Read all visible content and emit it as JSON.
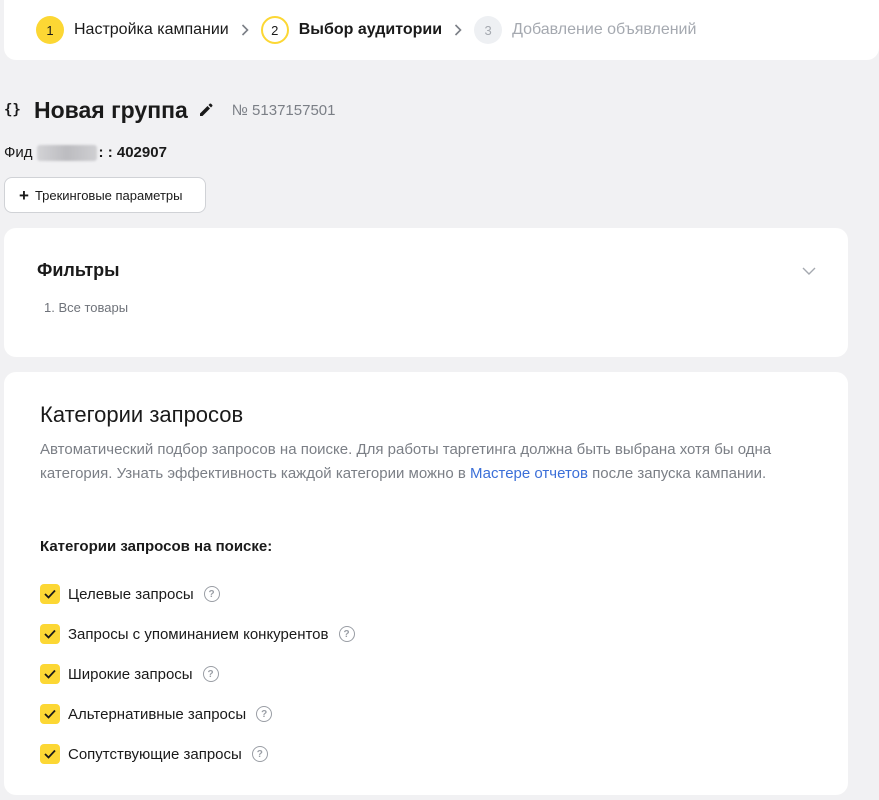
{
  "stepper": {
    "steps": [
      {
        "num": "1",
        "label": "Настройка кампании",
        "state": "done"
      },
      {
        "num": "2",
        "label": "Выбор аудитории",
        "state": "active"
      },
      {
        "num": "3",
        "label": "Добавление объявлений",
        "state": "pending"
      }
    ]
  },
  "group": {
    "icon": "{}",
    "title": "Новая группа",
    "number": "№ 5137157501"
  },
  "feed": {
    "prefix": "Фид",
    "id": ": : 402907"
  },
  "tracking_button": {
    "label": "Трекинговые параметры"
  },
  "filters": {
    "title": "Фильтры",
    "items": [
      "1. Все товары"
    ]
  },
  "categories": {
    "title": "Категории запросов",
    "desc_before": "Автоматический подбор запросов на поиске. Для работы таргетинга должна быть выбрана хотя бы одна категория. Узнать эффективность каждой категории можно в ",
    "desc_link": "Мастере отчетов",
    "desc_after": " после запуска кампании.",
    "subsection": "Категории запросов на поиске:",
    "options": [
      {
        "label": "Целевые запросы",
        "checked": true
      },
      {
        "label": "Запросы с упоминанием конкурентов",
        "checked": true
      },
      {
        "label": "Широкие запросы",
        "checked": true
      },
      {
        "label": "Альтернативные запросы",
        "checked": true
      },
      {
        "label": "Сопутствующие запросы",
        "checked": true
      }
    ],
    "help_glyph": "?"
  },
  "colors": {
    "accent": "#fcd734",
    "link": "#3b6fd8",
    "background": "#f1f1f3",
    "muted_text": "#7b7f86"
  }
}
